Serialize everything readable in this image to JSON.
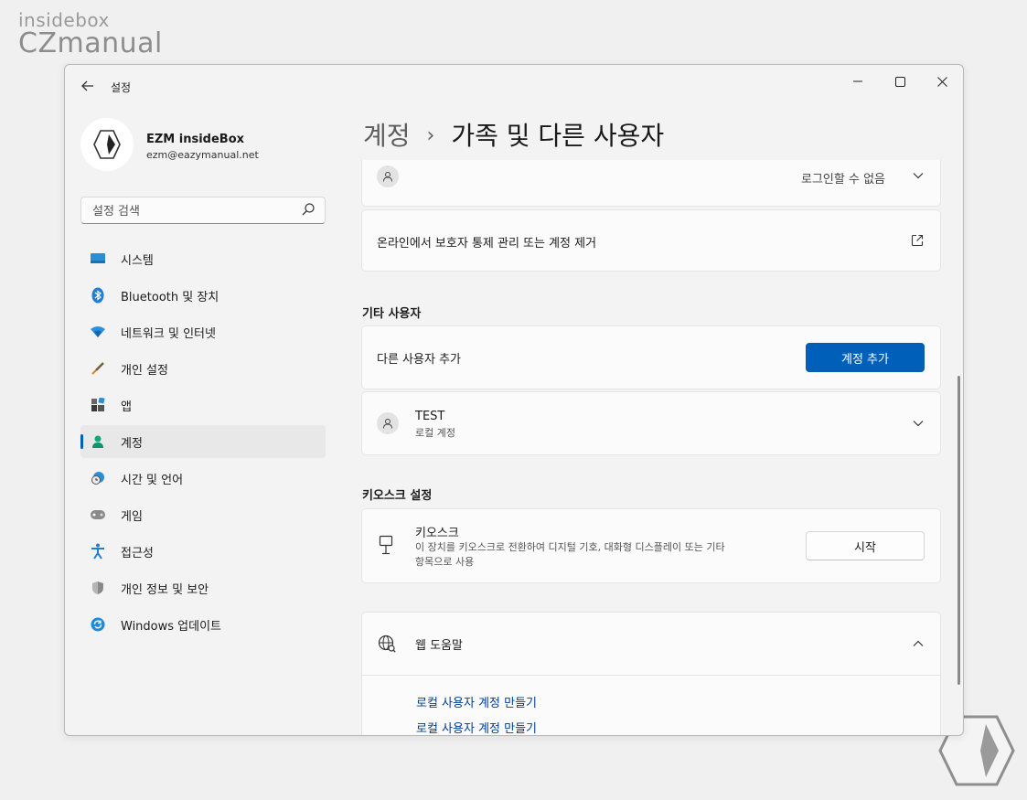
{
  "watermark": {
    "line1": "insidebox",
    "line2": "CZmanual"
  },
  "window": {
    "title": "설정"
  },
  "profile": {
    "name": "EZM insideBox",
    "email": "ezm@eazymanual.net"
  },
  "search": {
    "placeholder": "설정 검색"
  },
  "sidebar": {
    "items": [
      {
        "label": "시스템",
        "icon": "monitor-icon"
      },
      {
        "label": "Bluetooth 및 장치",
        "icon": "bluetooth-icon"
      },
      {
        "label": "네트워크 및 인터넷",
        "icon": "wifi-icon"
      },
      {
        "label": "개인 설정",
        "icon": "brush-icon"
      },
      {
        "label": "앱",
        "icon": "apps-icon"
      },
      {
        "label": "계정",
        "icon": "account-icon",
        "active": true
      },
      {
        "label": "시간 및 언어",
        "icon": "clock-globe-icon"
      },
      {
        "label": "게임",
        "icon": "gamepad-icon"
      },
      {
        "label": "접근성",
        "icon": "accessibility-icon"
      },
      {
        "label": "개인 정보 및 보안",
        "icon": "shield-icon"
      },
      {
        "label": "Windows 업데이트",
        "icon": "update-icon"
      }
    ]
  },
  "breadcrumb": {
    "parent": "계정",
    "separator": "›",
    "current": "가족 및 다른 사용자"
  },
  "family": {
    "member_status": "로그인할 수 없음",
    "online_manage": "온라인에서 보호자 통제 관리 또는 계정 제거"
  },
  "other_users": {
    "title": "기타 사용자",
    "add_label": "다른 사용자 추가",
    "add_button": "계정 추가",
    "user_name": "TEST",
    "user_type": "로컬 계정"
  },
  "kiosk": {
    "title": "키오스크 설정",
    "name": "키오스크",
    "description_line1": "이 장치를 키오스크로 전환하여 디지털 기호, 대화형 디스플레이 또는 기타",
    "description_line2": "항목으로 사용",
    "button": "시작"
  },
  "web_help": {
    "title": "웹 도움말",
    "links": [
      "로컬 사용자 계정 만들기",
      "로컬 사용자 계정 만들기"
    ]
  },
  "colors": {
    "accent": "#005fb8",
    "link": "#003e92"
  }
}
